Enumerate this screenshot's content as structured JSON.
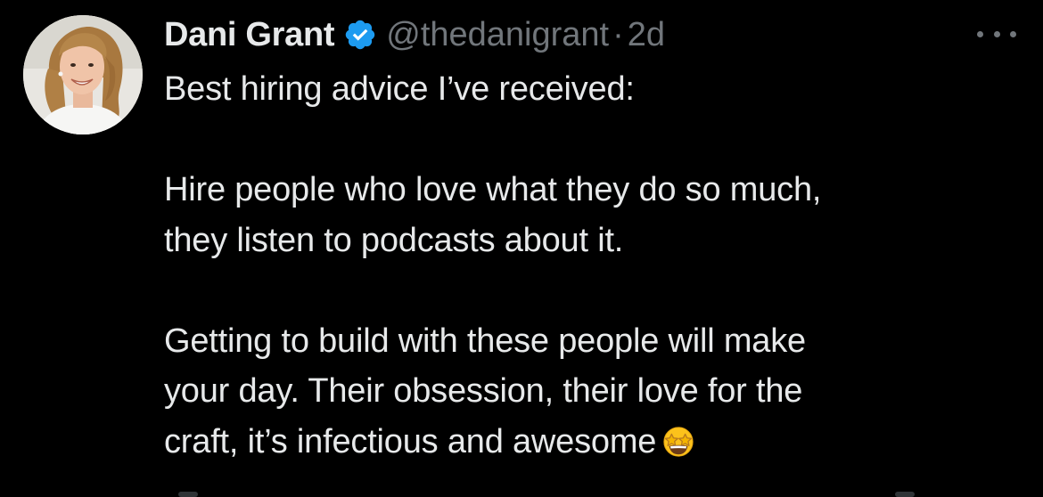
{
  "tweet": {
    "author": {
      "display_name": "Dani Grant",
      "verified": true,
      "verified_icon": "verified-badge-icon",
      "handle": "@thedanigrant",
      "separator": "·",
      "timestamp": "2d"
    },
    "more_icon": "more-options-icon",
    "text": {
      "line1": "Best hiring advice I’ve received:",
      "line2": "Hire people who love what they do so much,",
      "line3": "they listen to podcasts about it.",
      "line4": "Getting to build with these people will make",
      "line5": "your day. Their obsession, their love for the",
      "line6": "craft, it’s infectious and awesome",
      "emoji": "star-struck-emoji"
    }
  },
  "colors": {
    "background": "#000000",
    "primary_text": "#e7e9ea",
    "secondary_text": "#71767b",
    "verified_blue": "#1d9bf0"
  }
}
